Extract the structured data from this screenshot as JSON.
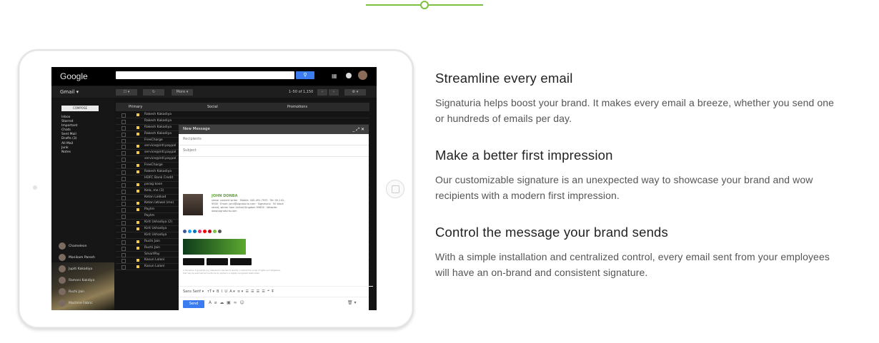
{
  "sections": [
    {
      "heading": "Streamline every email",
      "body": "Signaturia helps boost your brand. It makes every email a breeze, whether you send one or hundreds of emails per day."
    },
    {
      "heading": "Make a better first impression",
      "body": "Our customizable signature is an unexpected way to showcase your brand and wow recipients with a modern first impression."
    },
    {
      "heading": "Control the message your brand sends",
      "body": "With a simple installation and centralized control, every email sent from your employees will have an on-brand and consistent signature."
    }
  ],
  "mockup": {
    "google_logo": "Google",
    "gmail_label": "Gmail ▾",
    "more_label": "More ▾",
    "count": "1–50 of 1,150",
    "compose_label": "COMPOSE",
    "nav": [
      "Inbox",
      "Starred",
      "Important",
      "Chats",
      "Sent Mail",
      "Drafts (3)",
      "All Mail",
      "Junk",
      "Notes"
    ],
    "tabs": [
      "Primary",
      "Social",
      "Promotions"
    ],
    "rows": [
      "Rakesh Kakadiya",
      "Rakesh Kakadiya",
      "Rakesh Kakadiya",
      "Rakesh Kakadiya",
      "FreeCharge",
      "service@intl.paypal",
      "service@intl.paypal",
      "service@intl.paypal",
      "FreeCharge",
      "Rakesh Kakadiya",
      "HDFC Bank Credit",
      "parag koon",
      "Kela, me (3)",
      "Ketan Lakkad",
      "Ketan latiwal (me)",
      "Paytm",
      "Paytm",
      "Kirit Ushadiya (2)",
      "Kirit Ushadiya",
      "Kirit Ushadiya",
      "Ruchi Jain",
      "Ruchi Jain",
      "SmartPay",
      "Kasun Lalani",
      "Kasun Lalani"
    ],
    "users": [
      "Chameleon",
      "Manikam Paresh",
      "Jupiti Kakadiya",
      "Ramani Kakdiya",
      "Ruchi Jain",
      "Machine Fabric"
    ],
    "compose_title": "New Message",
    "recipients_placeholder": "Recipients",
    "subject_placeholder": "Subject",
    "sig_name": "JOHN DONBA",
    "sig_info": "senior content writer · Mobile: 440-491-7933 · Tel: 00-142-9000 · Email: john@signaturia.com · Signaturia · 50 block street, winter ham United Kingdom 99600 · Website: www.signaturia.com",
    "sig_disclaimer": "A disclaimer is generally any statement intended to specify or delimit the scope of rights and obligations that may be exercised and enforced by parties in a legally recognized relationship.",
    "toolbar_font": "Sans Serif ▾",
    "send_label": "Send"
  },
  "colors": {
    "accent_green": "#7cc142",
    "gmail_blue": "#3b7df0"
  }
}
